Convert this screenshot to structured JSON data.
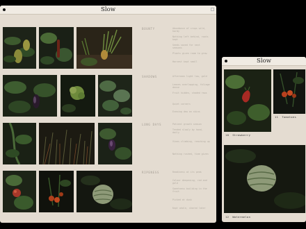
{
  "main_window": {
    "title": "Slow",
    "sections": [
      {
        "title": "Bounty",
        "notes": [
          "Abundance of crops wild, hardy",
          "Nothing left behind, roots kept",
          "Seeds saved for next seasons",
          "Plants given room to grow",
          "Harvest kept small"
        ]
      },
      {
        "title": "Shadows",
        "notes": [
          "Afternoon light low, gold",
          "Leaves overlapping, foliage dense",
          "Fruit hidden, shaded rows",
          "Quiet corners",
          "Evening dew on skins"
        ]
      },
      {
        "title": "Long Days",
        "notes": [
          "Patient growth season",
          "Tended slowly by hand, daily",
          "Vines climbing, reaching up",
          "Nothing rushed, time given"
        ]
      },
      {
        "title": "Ripeness",
        "notes": [
          "Readiness at its peak",
          "Colour deepening, red and gold",
          "Sweetness building in the fruit",
          "Picked at dusk",
          "Kept whole, shared later"
        ]
      }
    ]
  },
  "side_window": {
    "title": "Slow",
    "items": [
      {
        "number": "10",
        "label": "Strawberry"
      },
      {
        "number": "11",
        "label": "Tomatoes"
      },
      {
        "number": "12",
        "label": "Watermelon"
      }
    ]
  }
}
